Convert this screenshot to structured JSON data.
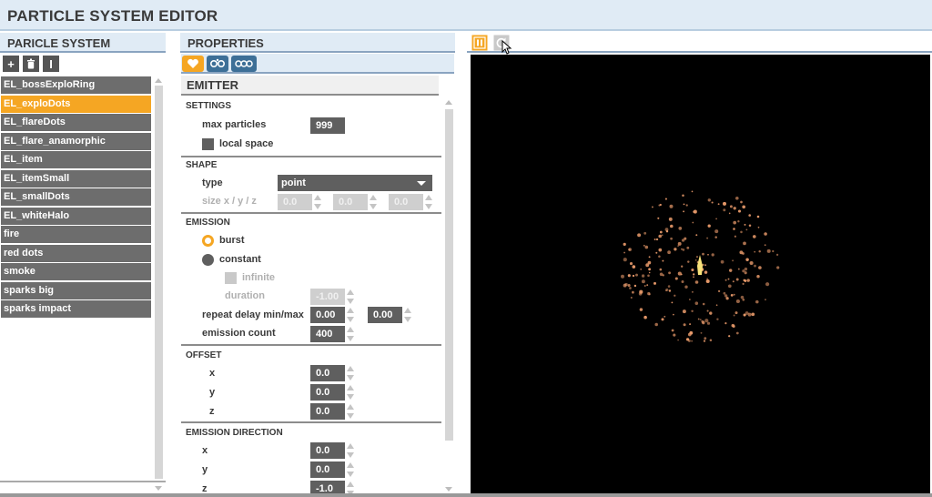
{
  "app": {
    "title": "PARTICLE SYSTEM EDITOR"
  },
  "left_panel": {
    "title": "PARICLE SYSTEM",
    "toolbar": {
      "add": "+",
      "rename": "I"
    },
    "items": [
      {
        "label": "EL_bossExploRing",
        "selected": false
      },
      {
        "label": "EL_exploDots",
        "selected": true
      },
      {
        "label": "EL_flareDots",
        "selected": false
      },
      {
        "label": "EL_flare_anamorphic",
        "selected": false
      },
      {
        "label": "EL_item",
        "selected": false
      },
      {
        "label": "EL_itemSmall",
        "selected": false
      },
      {
        "label": "EL_smallDots",
        "selected": false
      },
      {
        "label": "EL_whiteHalo",
        "selected": false
      },
      {
        "label": "fire",
        "selected": false
      },
      {
        "label": "red dots",
        "selected": false
      },
      {
        "label": "smoke",
        "selected": false
      },
      {
        "label": "sparks big",
        "selected": false
      },
      {
        "label": "sparks impact",
        "selected": false
      }
    ]
  },
  "properties": {
    "title": "PROPERTIES",
    "tabs": [
      "heart-icon",
      "emitter-dots-icon",
      "emitter-chain-icon"
    ],
    "section_title": "EMITTER",
    "settings": {
      "title": "SETTINGS",
      "max_particles_label": "max particles",
      "max_particles": "999",
      "local_space_label": "local space"
    },
    "shape": {
      "title": "SHAPE",
      "type_label": "type",
      "type_value": "point",
      "size_label": "size x / y / z",
      "size_x": "0.0",
      "size_y": "0.0",
      "size_z": "0.0"
    },
    "emission": {
      "title": "EMISSION",
      "burst_label": "burst",
      "constant_label": "constant",
      "infinite_label": "infinite",
      "duration_label": "duration",
      "duration": "-1.00",
      "repeat_delay_label": "repeat delay min/max",
      "repeat_delay_min": "0.00",
      "repeat_delay_max": "0.00",
      "emission_count_label": "emission count",
      "emission_count": "400"
    },
    "offset": {
      "title": "OFFSET",
      "x_label": "x",
      "x": "0.0",
      "y_label": "y",
      "y": "0.0",
      "z_label": "z",
      "z": "0.0"
    },
    "emission_direction": {
      "title": "EMISSION DIRECTION",
      "x_label": "x",
      "x": "0.0",
      "y_label": "y",
      "y": "0.0",
      "z_label": "z",
      "z": "-1.0"
    }
  },
  "preview": {
    "buttons": [
      "pause-icon",
      "reset-icon"
    ],
    "background_color": "#000000",
    "particle_color": "#e89a6a",
    "core_color": "#f7e27a"
  },
  "colors": {
    "accent": "#f5a623",
    "header_bg": "#e0ebf5",
    "item_bg": "#6d6d6d"
  }
}
